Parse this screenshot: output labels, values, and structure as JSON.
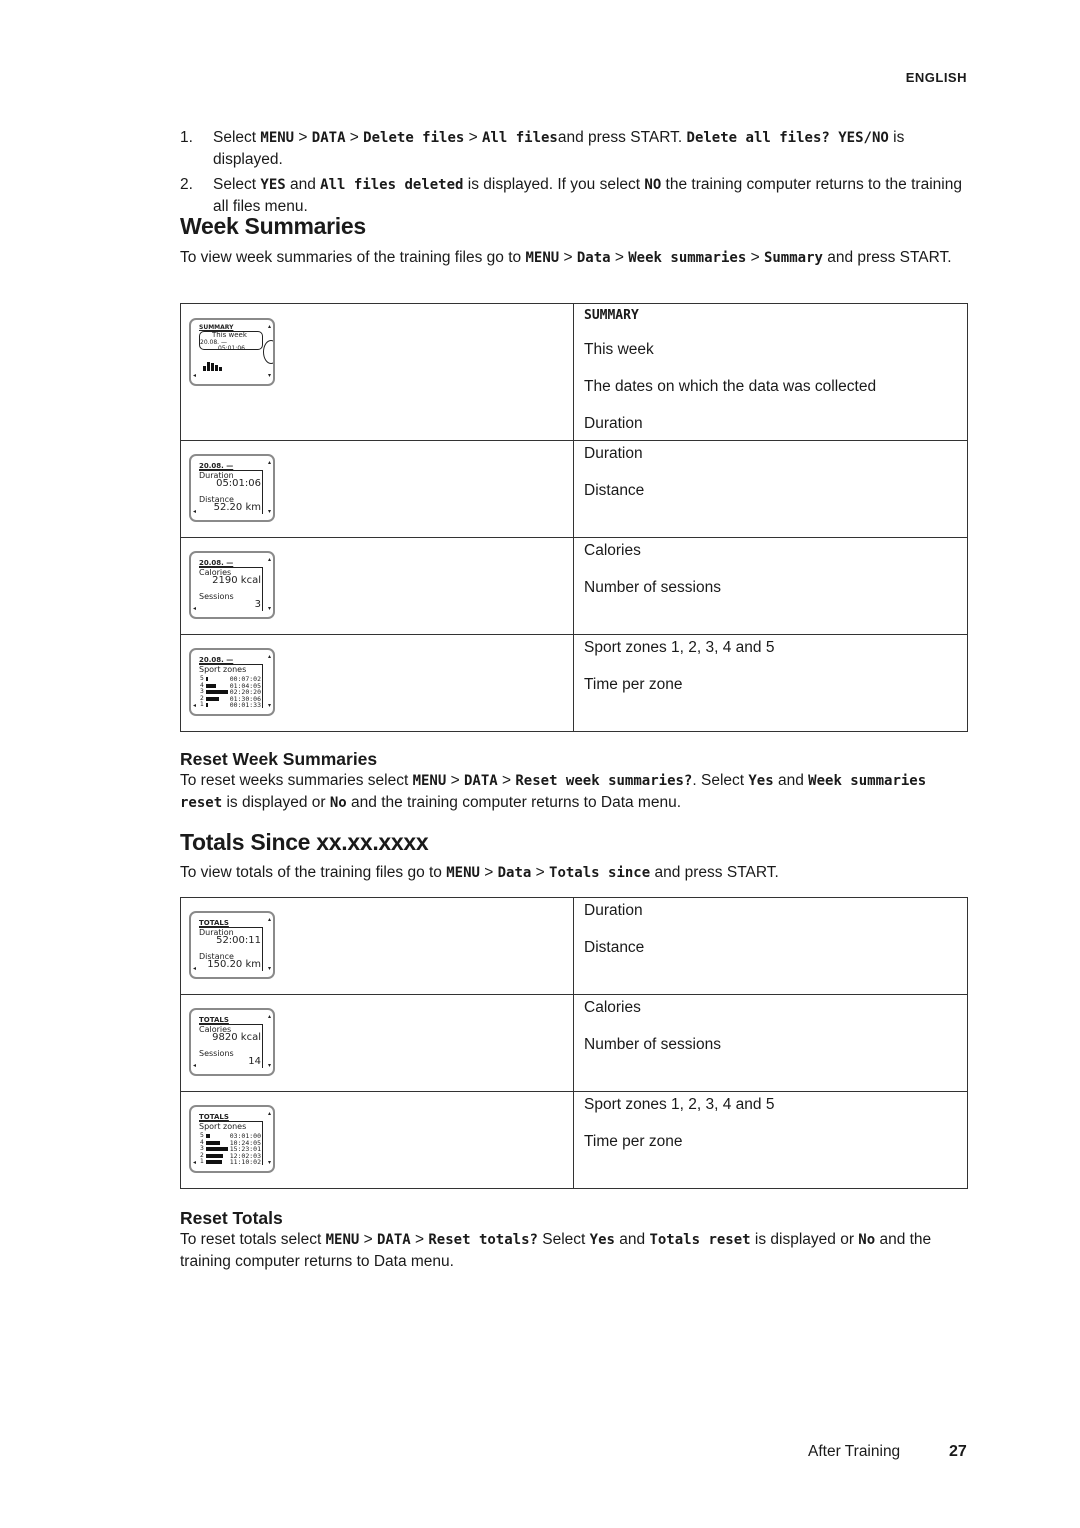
{
  "header": {
    "language": "ENGLISH"
  },
  "intro_steps": [
    {
      "num": "1.",
      "parts": [
        {
          "t": "Select "
        },
        {
          "t": "MENU",
          "lcd": true
        },
        {
          "t": " > "
        },
        {
          "t": "DATA",
          "lcd": true
        },
        {
          "t": " > "
        },
        {
          "t": "Delete files",
          "lcd": true
        },
        {
          "t": " > "
        },
        {
          "t": "All files",
          "lcd": true
        },
        {
          "t": "and press START. "
        },
        {
          "t": "Delete all files? YES/NO",
          "lcd": true
        },
        {
          "t": "  is displayed."
        }
      ]
    },
    {
      "num": "2.",
      "parts": [
        {
          "t": "Select "
        },
        {
          "t": "YES",
          "lcd": true
        },
        {
          "t": " and "
        },
        {
          "t": "All files deleted",
          "lcd": true
        },
        {
          "t": "  is displayed. If you select "
        },
        {
          "t": "NO",
          "lcd": true
        },
        {
          "t": " the training computer returns to the training all files menu."
        }
      ]
    }
  ],
  "week_summaries": {
    "title": "Week Summaries",
    "intro": [
      {
        "t": "To view week summaries of the training files go to "
      },
      {
        "t": "MENU",
        "lcd": true
      },
      {
        "t": " > "
      },
      {
        "t": "Data",
        "lcd": true
      },
      {
        "t": " > "
      },
      {
        "t": "Week summaries",
        "lcd": true
      },
      {
        "t": " > "
      },
      {
        "t": "Summary",
        "lcd": true
      },
      {
        "t": " and press START."
      }
    ],
    "rows": [
      {
        "screen": {
          "type": "summary",
          "header": "SUMMARY",
          "bubble_title": "This week",
          "date": "20.08. —",
          "time": "05:01:06"
        },
        "heading": "SUMMARY",
        "lines": [
          "This week",
          "The dates on which the data was collected",
          "Duration"
        ]
      },
      {
        "screen": {
          "type": "two-values",
          "header": "20.08. —",
          "label1": "Duration",
          "value1": "05:01:06",
          "label2": "Distance",
          "value2": "52.20 km"
        },
        "lines": [
          "Duration",
          "Distance"
        ]
      },
      {
        "screen": {
          "type": "two-values",
          "header": "20.08. —",
          "label1": "Calories",
          "value1": "2190 kcal",
          "label2": "Sessions",
          "value2": "3"
        },
        "lines": [
          "Calories",
          "Number of sessions"
        ]
      },
      {
        "screen": {
          "type": "zones",
          "header": "20.08. —",
          "label": "Sport zones",
          "zones": [
            {
              "zone": "5",
              "time": "00:07:02",
              "fraction": 0.1
            },
            {
              "zone": "4",
              "time": "01:04:05",
              "fraction": 0.45
            },
            {
              "zone": "3",
              "time": "02:20:20",
              "fraction": 1.0
            },
            {
              "zone": "2",
              "time": "01:30:06",
              "fraction": 0.6
            },
            {
              "zone": "1",
              "time": "00:01:33",
              "fraction": 0.05
            }
          ]
        },
        "lines": [
          "Sport zones 1, 2, 3, 4 and 5",
          "Time per zone"
        ]
      }
    ]
  },
  "reset_week": {
    "title": "Reset Week Summaries",
    "text": [
      {
        "t": "To reset weeks summaries select "
      },
      {
        "t": "MENU",
        "lcd": true
      },
      {
        "t": " > "
      },
      {
        "t": "DATA",
        "lcd": true
      },
      {
        "t": " > "
      },
      {
        "t": "Reset week summaries?",
        "lcd": true
      },
      {
        "t": ". Select "
      },
      {
        "t": "Yes",
        "lcd": true
      },
      {
        "t": " and "
      },
      {
        "t": "Week summaries reset",
        "lcd": true
      },
      {
        "t": " is displayed or "
      },
      {
        "t": "No",
        "lcd": true
      },
      {
        "t": " and the training computer returns to Data menu."
      }
    ]
  },
  "totals": {
    "title": "Totals Since xx.xx.xxxx",
    "intro": [
      {
        "t": "To view totals of the training files go to "
      },
      {
        "t": "MENU",
        "lcd": true
      },
      {
        "t": " > "
      },
      {
        "t": "Data",
        "lcd": true
      },
      {
        "t": " > "
      },
      {
        "t": "Totals since",
        "lcd": true
      },
      {
        "t": " and press START."
      }
    ],
    "rows": [
      {
        "screen": {
          "type": "two-values",
          "header": "TOTALS",
          "label1": "Duration",
          "value1": "52:00:11",
          "label2": "Distance",
          "value2": "150.20 km"
        },
        "lines": [
          "Duration",
          "Distance"
        ]
      },
      {
        "screen": {
          "type": "two-values",
          "header": "TOTALS",
          "label1": "Calories",
          "value1": "9820 kcal",
          "label2": "Sessions",
          "value2": "14"
        },
        "lines": [
          "Calories",
          "Number of sessions"
        ]
      },
      {
        "screen": {
          "type": "zones",
          "header": "TOTALS",
          "label": "Sport zones",
          "zones": [
            {
              "zone": "5",
              "time": "03:01:00",
              "fraction": 0.2
            },
            {
              "zone": "4",
              "time": "10:24:05",
              "fraction": 0.65
            },
            {
              "zone": "3",
              "time": "15:23:01",
              "fraction": 1.0
            },
            {
              "zone": "2",
              "time": "12:02:03",
              "fraction": 0.78
            },
            {
              "zone": "1",
              "time": "11:10:02",
              "fraction": 0.72
            }
          ]
        },
        "lines": [
          "Sport zones 1, 2, 3, 4 and 5",
          "Time per zone"
        ]
      }
    ]
  },
  "reset_totals": {
    "title": "Reset Totals",
    "text": [
      {
        "t": "To reset totals select "
      },
      {
        "t": "MENU",
        "lcd": true
      },
      {
        "t": " > "
      },
      {
        "t": "DATA",
        "lcd": true
      },
      {
        "t": " > "
      },
      {
        "t": "Reset totals?",
        "lcd": true
      },
      {
        "t": " Select "
      },
      {
        "t": "Yes",
        "lcd": true
      },
      {
        "t": " and "
      },
      {
        "t": "Totals reset",
        "lcd": true
      },
      {
        "t": " is displayed or "
      },
      {
        "t": "No",
        "lcd": true
      },
      {
        "t": " and the training computer returns to Data menu."
      }
    ]
  },
  "footer": {
    "section": "After Training",
    "page": "27"
  }
}
